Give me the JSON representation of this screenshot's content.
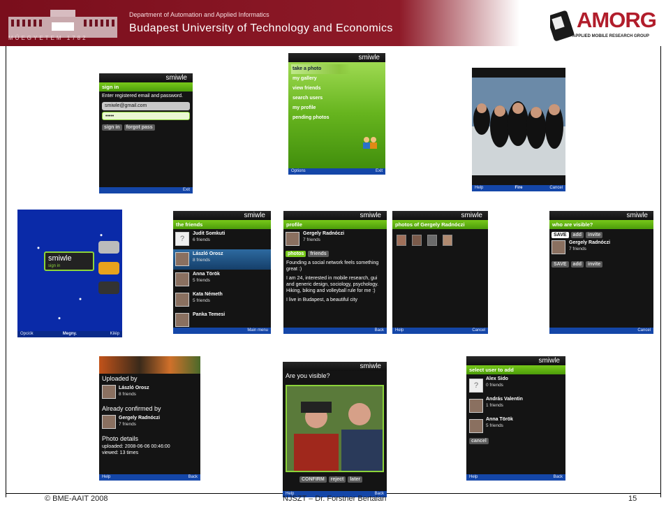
{
  "header": {
    "dept": "Department of Automation and Applied Informatics",
    "university": "Budapest University of Technology and Economics",
    "motto": "MŰEGYETEM 1782",
    "lab_word": "AMORG",
    "lab_sub": "APPLIED MOBILE RESEARCH GROUP"
  },
  "footer": {
    "left": "© BME-AAIT 2008",
    "center": "NJSZT – Dr. Forstner Bertalan",
    "page": "15"
  },
  "brand": "smiwle",
  "signin": {
    "title": "sign in",
    "prompt": "Enter registered email and password.",
    "email": "smiwle@gmail.com",
    "password": "•••••",
    "btn_signin": "sign in",
    "btn_forgot": "forgot pass",
    "soft_right": "Exit"
  },
  "mainmenu": {
    "items": [
      "take a photo",
      "my gallery",
      "view friends",
      "search users",
      "my profile",
      "pending photos"
    ],
    "soft_left": "Options",
    "soft_right": "Exit"
  },
  "camera": {
    "soft_left": "Help",
    "soft_center": "Fire",
    "soft_right": "Cancel"
  },
  "launcher": {
    "app": "smiwle",
    "sub": "sign in",
    "soft_left": "Opciók",
    "soft_center": "Megny.",
    "soft_right": "Kilép"
  },
  "friends": {
    "title": "the friends",
    "items": [
      {
        "name": "Judit Somkuti",
        "count": "6 friends"
      },
      {
        "name": "László Orosz",
        "count": "8 friends"
      },
      {
        "name": "Anna Török",
        "count": "5 friends"
      },
      {
        "name": "Kata Németh",
        "count": "5 friends"
      },
      {
        "name": "Panka Temesi",
        "count": ""
      }
    ],
    "soft_right": "Main menu"
  },
  "profile": {
    "title": "profile",
    "name": "Gergely Radnóczi",
    "count": "7 friends",
    "tab_photos": "photos",
    "tab_friends": "friends",
    "bio1": "Founding a social network feels something great :)",
    "bio2": "I am 24, interested in mobile research, gui and generic design, sociology, psychology. Hiking, biking and volleyball rule for me :)",
    "bio3": "I live in Budapest, a beautiful city",
    "soft_right": "Back"
  },
  "photosof": {
    "title": "photos of Gergely Radnóczi",
    "soft_left": "Help",
    "soft_right": "Cancel"
  },
  "visible": {
    "title": "who are visible?",
    "btn_save": "SAVE",
    "btn_add": "add",
    "btn_invite": "invite",
    "name": "Gergely Radnóczi",
    "count": "7 friends",
    "soft_right": "Cancel"
  },
  "photodetail": {
    "uploaded_by": "Uploaded by",
    "uploader": "László Orosz",
    "uploader_count": "8 friends",
    "confirmed_by": "Already confirmed by",
    "confirmer": "Gergely Radnóczi",
    "confirmer_count": "7 friends",
    "details": "Photo details",
    "uploaded": "uploaded: 2008-06-06 00:46:00",
    "viewed": "viewed: 13 times",
    "soft_left": "Help",
    "soft_right": "Back"
  },
  "areyouvisible": {
    "question": "Are you visible?",
    "btn_confirm": "CONFIRM",
    "btn_reject": "reject",
    "btn_later": "later",
    "soft_left": "Help",
    "soft_right": "Back"
  },
  "selectuser": {
    "title": "select user to add",
    "items": [
      {
        "name": "Alex Sido",
        "count": "0 friends"
      },
      {
        "name": "András Valentin",
        "count": "1 friends"
      },
      {
        "name": "Anna Török",
        "count": "5 friends"
      }
    ],
    "btn_cancel": "cancel",
    "soft_left": "Help",
    "soft_right": "Back"
  }
}
